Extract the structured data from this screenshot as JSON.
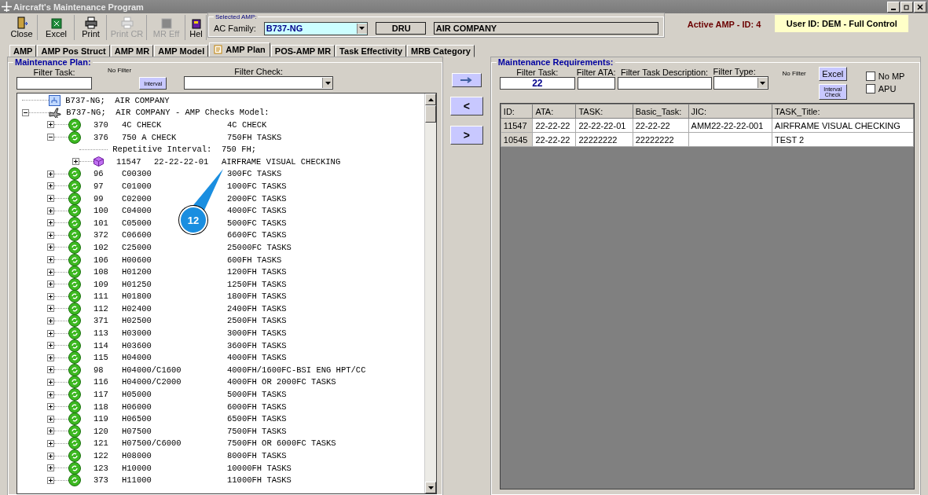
{
  "window": {
    "title": "Aircraft's Maintenance Program"
  },
  "toolbar": [
    {
      "label": "Close",
      "kind": "door",
      "disabled": false
    },
    {
      "label": "Excel",
      "kind": "excel",
      "disabled": false
    },
    {
      "label": "Print",
      "kind": "printer",
      "disabled": false
    },
    {
      "label": "Print CR",
      "kind": "printer",
      "disabled": true
    },
    {
      "label": "MR Eff",
      "kind": "square",
      "disabled": true
    },
    {
      "label": "Hel",
      "kind": "book",
      "disabled": false
    }
  ],
  "selected_amp": {
    "legend": "Selected AMP:",
    "ac_family_label": "AC Family:",
    "ac_family_value": "B737-NG",
    "code": "DRU",
    "company": "AIR COMPANY"
  },
  "active_amp": "Active AMP - ID: 4",
  "user": "User ID: DEM - Full Control",
  "tabs": [
    {
      "label": "AMP",
      "selected": false
    },
    {
      "label": "AMP Pos Struct",
      "selected": false
    },
    {
      "label": "AMP MR",
      "selected": false
    },
    {
      "label": "AMP Model",
      "selected": false
    },
    {
      "label": "AMP Plan",
      "selected": true
    },
    {
      "label": "POS-AMP MR",
      "selected": false
    },
    {
      "label": "Task Effectivity",
      "selected": false
    },
    {
      "label": "MRB Category",
      "selected": false
    }
  ],
  "maintenance_plan": {
    "title": "Maintenance Plan:",
    "filter_task_label": "Filter Task:",
    "no_filter": "No Filter",
    "interval_button": "Interval",
    "filter_check_label": "Filter Check:"
  },
  "tree": [
    {
      "kind": "root",
      "text": "B737-NG;  AIR COMPANY"
    },
    {
      "kind": "model",
      "text": "B737-NG;  AIR COMPANY - AMP Checks Model:",
      "expanded": true,
      "children": [
        {
          "kind": "check",
          "number": "370",
          "code": "4C CHECK",
          "description": "4C CHECK",
          "expanded": false
        },
        {
          "kind": "check",
          "number": "376",
          "code": "750 A CHECK",
          "description": "750FH TASKS",
          "expanded": true,
          "children": [
            {
              "kind": "note",
              "text": "Repetitive Interval:  750 FH;"
            },
            {
              "kind": "task",
              "number": "11547",
              "code": "22-22-22-01",
              "description": "AIRFRAME VISUAL CHECKING",
              "expanded": false
            }
          ]
        },
        {
          "kind": "check",
          "number": "96",
          "code": "C00300",
          "description": "300FC TASKS",
          "expanded": false
        },
        {
          "kind": "check",
          "number": "97",
          "code": "C01000",
          "description": "1000FC TASKS",
          "expanded": false
        },
        {
          "kind": "check",
          "number": "99",
          "code": "C02000",
          "description": "2000FC TASKS",
          "expanded": false
        },
        {
          "kind": "check",
          "number": "100",
          "code": "C04000",
          "description": "4000FC TASKS",
          "expanded": false
        },
        {
          "kind": "check",
          "number": "101",
          "code": "C05000",
          "description": "5000FC TASKS",
          "expanded": false
        },
        {
          "kind": "check",
          "number": "372",
          "code": "C06600",
          "description": "6600FC TASKS",
          "expanded": false
        },
        {
          "kind": "check",
          "number": "102",
          "code": "C25000",
          "description": "25000FC TASKS",
          "expanded": false
        },
        {
          "kind": "check",
          "number": "106",
          "code": "H00600",
          "description": "600FH TASKS",
          "expanded": false
        },
        {
          "kind": "check",
          "number": "108",
          "code": "H01200",
          "description": "1200FH TASKS",
          "expanded": false
        },
        {
          "kind": "check",
          "number": "109",
          "code": "H01250",
          "description": "1250FH TASKS",
          "expanded": false
        },
        {
          "kind": "check",
          "number": "111",
          "code": "H01800",
          "description": "1800FH TASKS",
          "expanded": false
        },
        {
          "kind": "check",
          "number": "112",
          "code": "H02400",
          "description": "2400FH TASKS",
          "expanded": false
        },
        {
          "kind": "check",
          "number": "371",
          "code": "H02500",
          "description": "2500FH TASKS",
          "expanded": false
        },
        {
          "kind": "check",
          "number": "113",
          "code": "H03000",
          "description": "3000FH TASKS",
          "expanded": false
        },
        {
          "kind": "check",
          "number": "114",
          "code": "H03600",
          "description": "3600FH TASKS",
          "expanded": false
        },
        {
          "kind": "check",
          "number": "115",
          "code": "H04000",
          "description": "4000FH TASKS",
          "expanded": false
        },
        {
          "kind": "check",
          "number": "98",
          "code": "H04000/C1600",
          "description": "4000FH/1600FC-BSI ENG HPT/CC",
          "expanded": false
        },
        {
          "kind": "check",
          "number": "116",
          "code": "H04000/C2000",
          "description": "4000FH OR 2000FC TASKS",
          "expanded": false
        },
        {
          "kind": "check",
          "number": "117",
          "code": "H05000",
          "description": "5000FH TASKS",
          "expanded": false
        },
        {
          "kind": "check",
          "number": "118",
          "code": "H06000",
          "description": "6000FH TASKS",
          "expanded": false
        },
        {
          "kind": "check",
          "number": "119",
          "code": "H06500",
          "description": "6500FH TASKS",
          "expanded": false
        },
        {
          "kind": "check",
          "number": "120",
          "code": "H07500",
          "description": "7500FH TASKS",
          "expanded": false
        },
        {
          "kind": "check",
          "number": "121",
          "code": "H07500/C6000",
          "description": "7500FH OR 6000FC TASKS",
          "expanded": false
        },
        {
          "kind": "check",
          "number": "122",
          "code": "H08000",
          "description": "8000FH TASKS",
          "expanded": false
        },
        {
          "kind": "check",
          "number": "123",
          "code": "H10000",
          "description": "10000FH TASKS",
          "expanded": false
        },
        {
          "kind": "check",
          "number": "373",
          "code": "H11000",
          "description": "11000FH TASKS",
          "expanded": false
        }
      ]
    }
  ],
  "move_buttons": [
    {
      "kind": "icon"
    },
    {
      "kind": "text",
      "label": "<"
    },
    {
      "kind": "text",
      "label": ">"
    }
  ],
  "maintenance_requirements": {
    "title": "Maintenance Requirements:",
    "filters": [
      {
        "label": "Filter Task:",
        "value": "22"
      },
      {
        "label": "Filter ATA:"
      },
      {
        "label": "Filter Task Description:"
      }
    ],
    "filter_type_label": "Filter Type:",
    "no_filter": "No Filter",
    "excel_button": "Excel",
    "interval_check_button": "Interval Check",
    "checkboxes": [
      {
        "label": "No MP",
        "checked": false
      },
      {
        "label": "APU",
        "checked": false
      }
    ],
    "table": {
      "columns": [
        "ID:",
        "ATA:",
        "TASK:",
        "Basic_Task:",
        "JIC:",
        "TASK_Title:"
      ],
      "rows": [
        [
          "11547",
          "22-22-22",
          "22-22-22-01",
          "22-22-22",
          "AMM22-22-22-001",
          "AIRFRAME VISUAL CHECKING"
        ],
        [
          "10545",
          "22-22-22",
          "22222222",
          "22222222",
          "",
          "TEST 2"
        ]
      ]
    }
  },
  "callout": {
    "number": "12"
  }
}
